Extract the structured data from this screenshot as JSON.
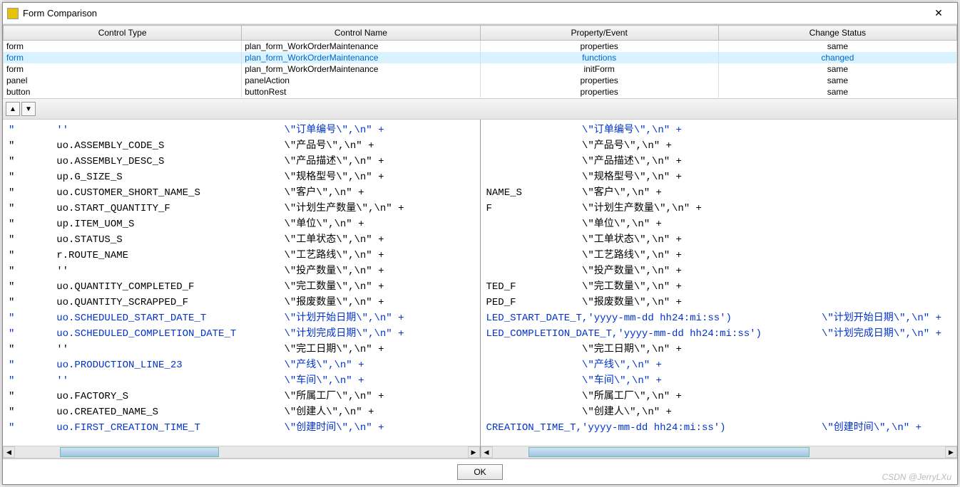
{
  "window": {
    "title": "Form Comparison"
  },
  "table": {
    "headers": [
      "Control Type",
      "Control Name",
      "Property/Event",
      "Change Status"
    ],
    "rows": [
      {
        "cells": [
          "form",
          "plan_form_WorkOrderMaintenance",
          "properties",
          "same"
        ],
        "selected": false
      },
      {
        "cells": [
          "form",
          "plan_form_WorkOrderMaintenance",
          "functions",
          "changed"
        ],
        "selected": true
      },
      {
        "cells": [
          "form",
          "plan_form_WorkOrderMaintenance",
          "initForm",
          "same"
        ],
        "selected": false
      },
      {
        "cells": [
          "panel",
          "panelAction",
          "properties",
          "same"
        ],
        "selected": false
      },
      {
        "cells": [
          "button",
          "buttonRest",
          "properties",
          "same"
        ],
        "selected": false
      }
    ]
  },
  "diff": {
    "left": [
      {
        "c": true,
        "pre": "\"       ''",
        "lbl": "\\\"订单编号\\\",\\n\" +"
      },
      {
        "c": false,
        "pre": "\"       uo.ASSEMBLY_CODE_S",
        "lbl": "\\\"产品号\\\",\\n\" +"
      },
      {
        "c": false,
        "pre": "\"       uo.ASSEMBLY_DESC_S",
        "lbl": "\\\"产品描述\\\",\\n\" +"
      },
      {
        "c": false,
        "pre": "\"       up.G_SIZE_S",
        "lbl": "\\\"规格型号\\\",\\n\" +"
      },
      {
        "c": false,
        "pre": "\"       uo.CUSTOMER_SHORT_NAME_S",
        "lbl": "\\\"客户\\\",\\n\" +"
      },
      {
        "c": false,
        "pre": "\"       uo.START_QUANTITY_F",
        "lbl": "\\\"计划生产数量\\\",\\n\" +"
      },
      {
        "c": false,
        "pre": "\"       up.ITEM_UOM_S",
        "lbl": "\\\"单位\\\",\\n\" +"
      },
      {
        "c": false,
        "pre": "\"       uo.STATUS_S",
        "lbl": "\\\"工单状态\\\",\\n\" +"
      },
      {
        "c": false,
        "pre": "\"       r.ROUTE_NAME",
        "lbl": "\\\"工艺路线\\\",\\n\" +"
      },
      {
        "c": false,
        "pre": "\"       ''",
        "lbl": "\\\"投产数量\\\",\\n\" +"
      },
      {
        "c": false,
        "pre": "\"       uo.QUANTITY_COMPLETED_F",
        "lbl": "\\\"完工数量\\\",\\n\" +"
      },
      {
        "c": false,
        "pre": "\"       uo.QUANTITY_SCRAPPED_F",
        "lbl": "\\\"报废数量\\\",\\n\" +"
      },
      {
        "c": true,
        "pre": "\"       uo.SCHEDULED_START_DATE_T",
        "lbl": "\\\"计划开始日期\\\",\\n\" +"
      },
      {
        "c": true,
        "pre": "\"       uo.SCHEDULED_COMPLETION_DATE_T",
        "lbl": "\\\"计划完成日期\\\",\\n\" +"
      },
      {
        "c": false,
        "pre": "\"       ''",
        "lbl": "\\\"完工日期\\\",\\n\" +"
      },
      {
        "c": true,
        "pre": "\"       uo.PRODUCTION_LINE_23",
        "lbl": "\\\"产线\\\",\\n\" +"
      },
      {
        "c": true,
        "pre": "\"       ''",
        "lbl": "\\\"车间\\\",\\n\" +"
      },
      {
        "c": false,
        "pre": "\"       uo.FACTORY_S",
        "lbl": "\\\"所属工厂\\\",\\n\" +"
      },
      {
        "c": false,
        "pre": "\"       uo.CREATED_NAME_S",
        "lbl": "\\\"创建人\\\",\\n\" +"
      },
      {
        "c": true,
        "pre": "\"       uo.FIRST_CREATION_TIME_T",
        "lbl": "\\\"创建时间\\\",\\n\" +"
      }
    ],
    "right": [
      {
        "c": true,
        "pre": "",
        "lbl": "\\\"订单编号\\\",\\n\" +"
      },
      {
        "c": false,
        "pre": "",
        "lbl": "\\\"产品号\\\",\\n\" +"
      },
      {
        "c": false,
        "pre": "",
        "lbl": "\\\"产品描述\\\",\\n\" +"
      },
      {
        "c": false,
        "pre": "",
        "lbl": "\\\"规格型号\\\",\\n\" +"
      },
      {
        "c": false,
        "pre": "NAME_S",
        "lbl": "\\\"客户\\\",\\n\" +"
      },
      {
        "c": false,
        "pre": "F",
        "lbl": "\\\"计划生产数量\\\",\\n\" +"
      },
      {
        "c": false,
        "pre": "",
        "lbl": "\\\"单位\\\",\\n\" +"
      },
      {
        "c": false,
        "pre": "",
        "lbl": "\\\"工单状态\\\",\\n\" +"
      },
      {
        "c": false,
        "pre": "",
        "lbl": "\\\"工艺路线\\\",\\n\" +"
      },
      {
        "c": false,
        "pre": "",
        "lbl": "\\\"投产数量\\\",\\n\" +"
      },
      {
        "c": false,
        "pre": "TED_F",
        "lbl": "\\\"完工数量\\\",\\n\" +"
      },
      {
        "c": false,
        "pre": "PED_F",
        "lbl": "\\\"报废数量\\\",\\n\" +"
      },
      {
        "c": true,
        "pre": "LED_START_DATE_T,'yyyy-mm-dd hh24:mi:ss')",
        "lbl": "\\\"计划开始日期\\\",\\n\" +"
      },
      {
        "c": true,
        "pre": "LED_COMPLETION_DATE_T,'yyyy-mm-dd hh24:mi:ss')",
        "lbl": "\\\"计划完成日期\\\",\\n\" +"
      },
      {
        "c": false,
        "pre": "",
        "lbl": "\\\"完工日期\\\",\\n\" +"
      },
      {
        "c": true,
        "pre": "",
        "lbl": "\\\"产线\\\",\\n\" +"
      },
      {
        "c": true,
        "pre": "",
        "lbl": "\\\"车间\\\",\\n\" +"
      },
      {
        "c": false,
        "pre": "",
        "lbl": "\\\"所属工厂\\\",\\n\" +"
      },
      {
        "c": false,
        "pre": "",
        "lbl": "\\\"创建人\\\",\\n\" +"
      },
      {
        "c": true,
        "pre": "CREATION_TIME_T,'yyyy-mm-dd hh24:mi:ss')",
        "lbl": "\\\"创建时间\\\",\\n\" +"
      }
    ]
  },
  "buttons": {
    "ok": "OK"
  },
  "watermark": "CSDN @JerryLXu"
}
